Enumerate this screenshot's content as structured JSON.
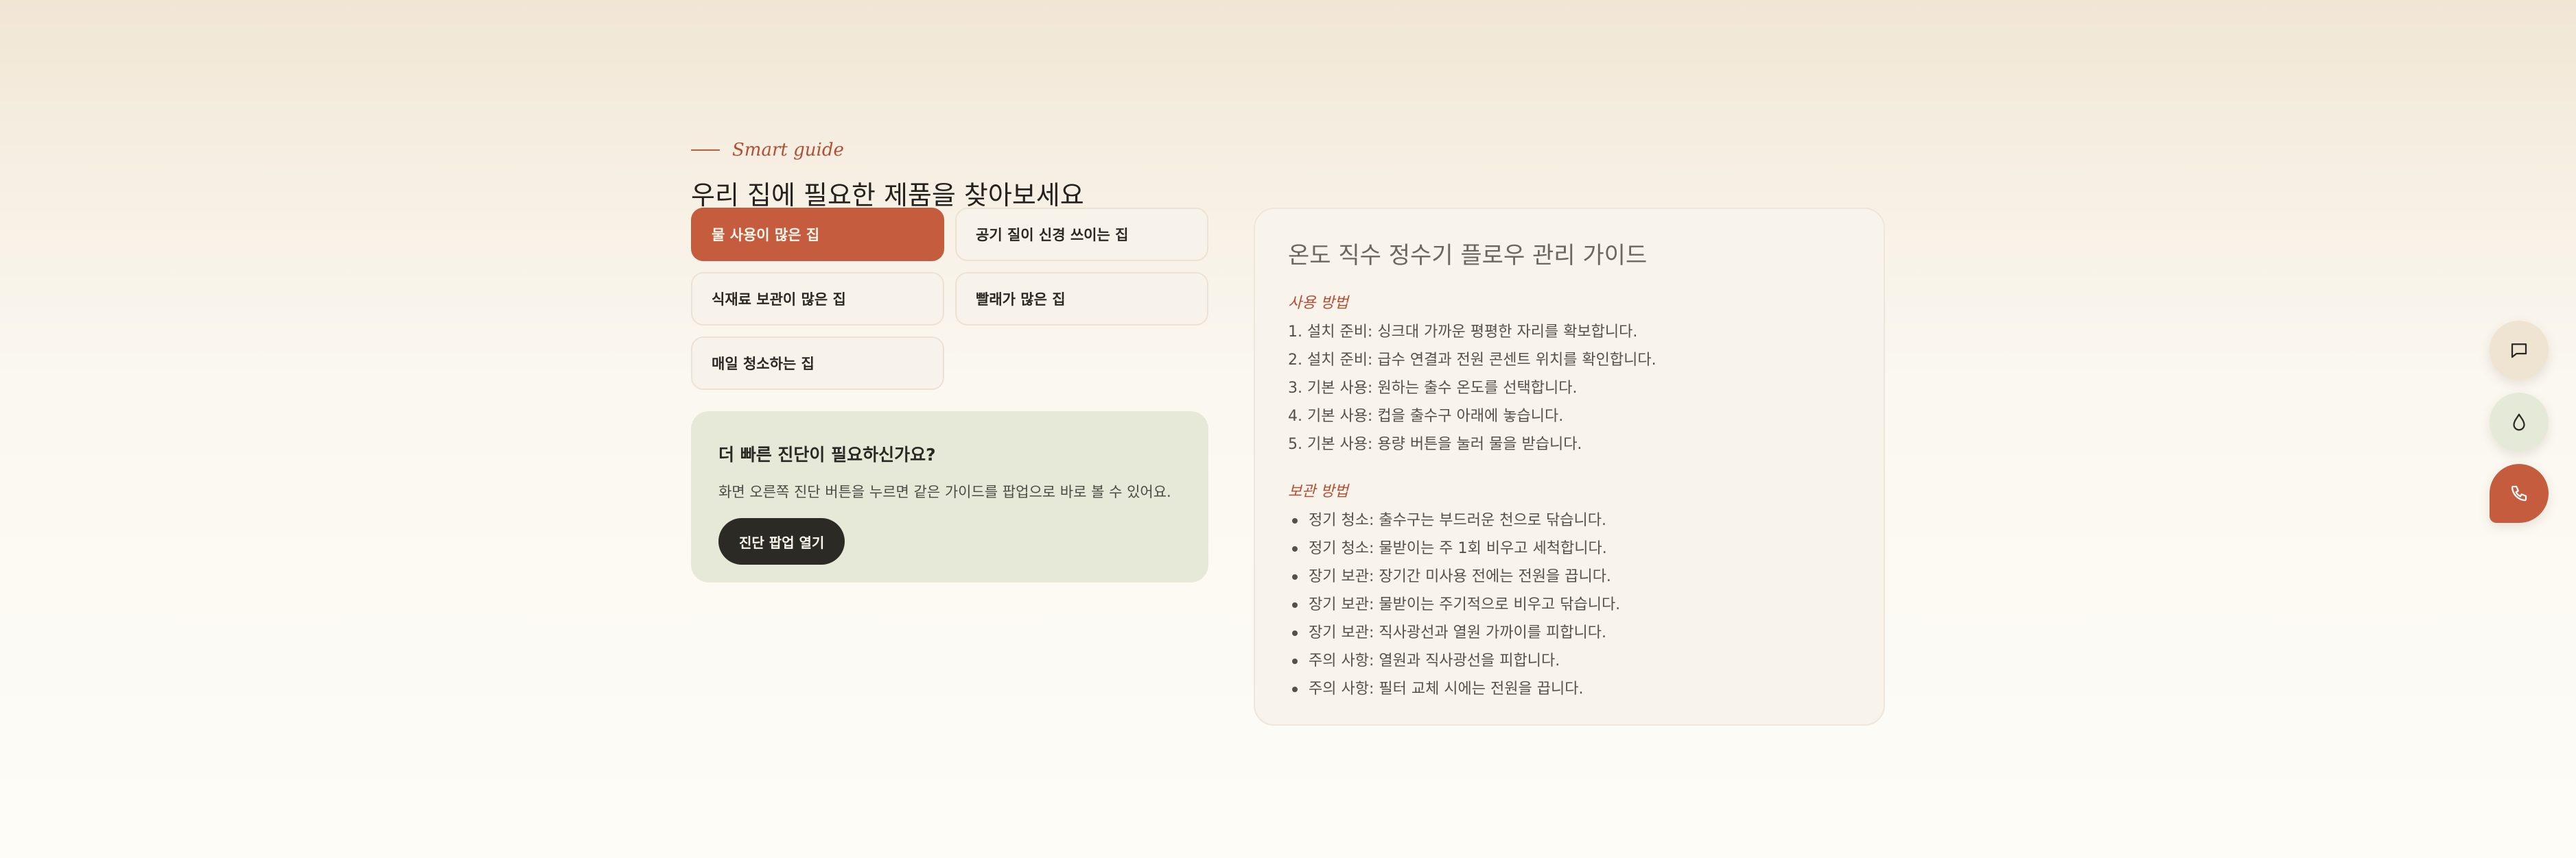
{
  "guide": {
    "eyebrow": "Smart guide",
    "title": "우리 집에 필요한 제품을 찾아보세요"
  },
  "options": [
    {
      "label": "물 사용이 많은 집",
      "active": true
    },
    {
      "label": "공기 질이 신경 쓰이는 집",
      "active": false
    },
    {
      "label": "식재료 보관이 많은 집",
      "active": false
    },
    {
      "label": "빨래가 많은 집",
      "active": false
    },
    {
      "label": "매일 청소하는 집",
      "active": false
    }
  ],
  "quick": {
    "title": "더 빠른 진단이 필요하신가요?",
    "description": "화면 오른쪽 진단 버튼을 누르면 같은 가이드를 팝업으로 바로 볼 수 있어요.",
    "button_label": "진단 팝업 열기"
  },
  "manual": {
    "title": "온도 직수 정수기 플로우 관리 가이드",
    "usage_heading": "사용 방법",
    "usage_steps": [
      "1. 설치 준비: 싱크대 가까운 평평한 자리를 확보합니다.",
      "2. 설치 준비: 급수 연결과 전원 콘센트 위치를 확인합니다.",
      "3. 기본 사용: 원하는 출수 온도를 선택합니다.",
      "4. 기본 사용: 컵을 출수구 아래에 놓습니다.",
      "5. 기본 사용: 용량 버튼을 눌러 물을 받습니다."
    ],
    "storage_heading": "보관 방법",
    "storage_tips": [
      "정기 청소: 출수구는 부드러운 천으로 닦습니다.",
      "정기 청소: 물받이는 주 1회 비우고 세척합니다.",
      "장기 보관: 장기간 미사용 전에는 전원을 끕니다.",
      "장기 보관: 물받이는 주기적으로 비우고 닦습니다.",
      "장기 보관: 직사광선과 열원 가까이를 피합니다.",
      "주의 사항: 열원과 직사광선을 피합니다.",
      "주의 사항: 필터 교체 시에는 전원을 끕니다."
    ]
  },
  "fabs": [
    {
      "icon": "chat-icon"
    },
    {
      "icon": "water-drop-icon"
    },
    {
      "icon": "phone-icon"
    }
  ],
  "colors": {
    "accent": "#c45c3d",
    "dark_button": "#2b2a24",
    "quick_panel": "#e6e9d8"
  }
}
